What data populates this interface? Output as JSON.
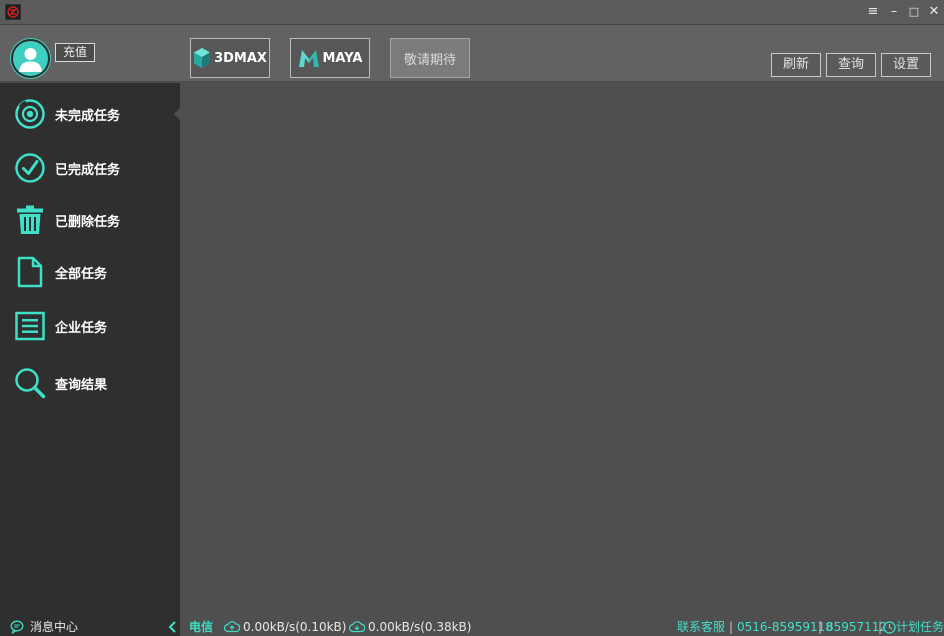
{
  "titlebar": {
    "menu_label": "≡",
    "minimize_label": "–",
    "maximize_label": "□",
    "close_label": "✕"
  },
  "header": {
    "recharge_label": "充值",
    "software": [
      {
        "label": "3DMAX",
        "icon": "3dmax-logo-icon"
      },
      {
        "label": "MAYA",
        "icon": "maya-logo-icon"
      },
      {
        "label": "敬请期待",
        "disabled": true
      }
    ],
    "actions": {
      "refresh_label": "刷新",
      "query_label": "查询",
      "settings_label": "设置"
    }
  },
  "sidebar": {
    "items": [
      {
        "label": "未完成任务",
        "icon": "pending-task-icon",
        "active": true
      },
      {
        "label": "已完成任务",
        "icon": "check-circle-icon"
      },
      {
        "label": "已删除任务",
        "icon": "trash-icon"
      },
      {
        "label": "全部任务",
        "icon": "document-icon"
      },
      {
        "label": "企业任务",
        "icon": "list-document-icon"
      },
      {
        "label": "查询结果",
        "icon": "search-icon"
      }
    ]
  },
  "statusbar": {
    "message_center_label": "消息中心",
    "network_label": "电信",
    "upload_rate": "0.00kB/s(0.10kB)",
    "download_rate": "0.00kB/s(0.38kB)",
    "contact_label": "联系客服",
    "phone_1": "0516-85959118",
    "phone_2": "85957112",
    "scheduled_task_label": "计划任务"
  },
  "colors": {
    "accent": "#3ee0c8",
    "sidebar_bg": "#2f2f2f",
    "main_bg": "#4f4f4f"
  }
}
